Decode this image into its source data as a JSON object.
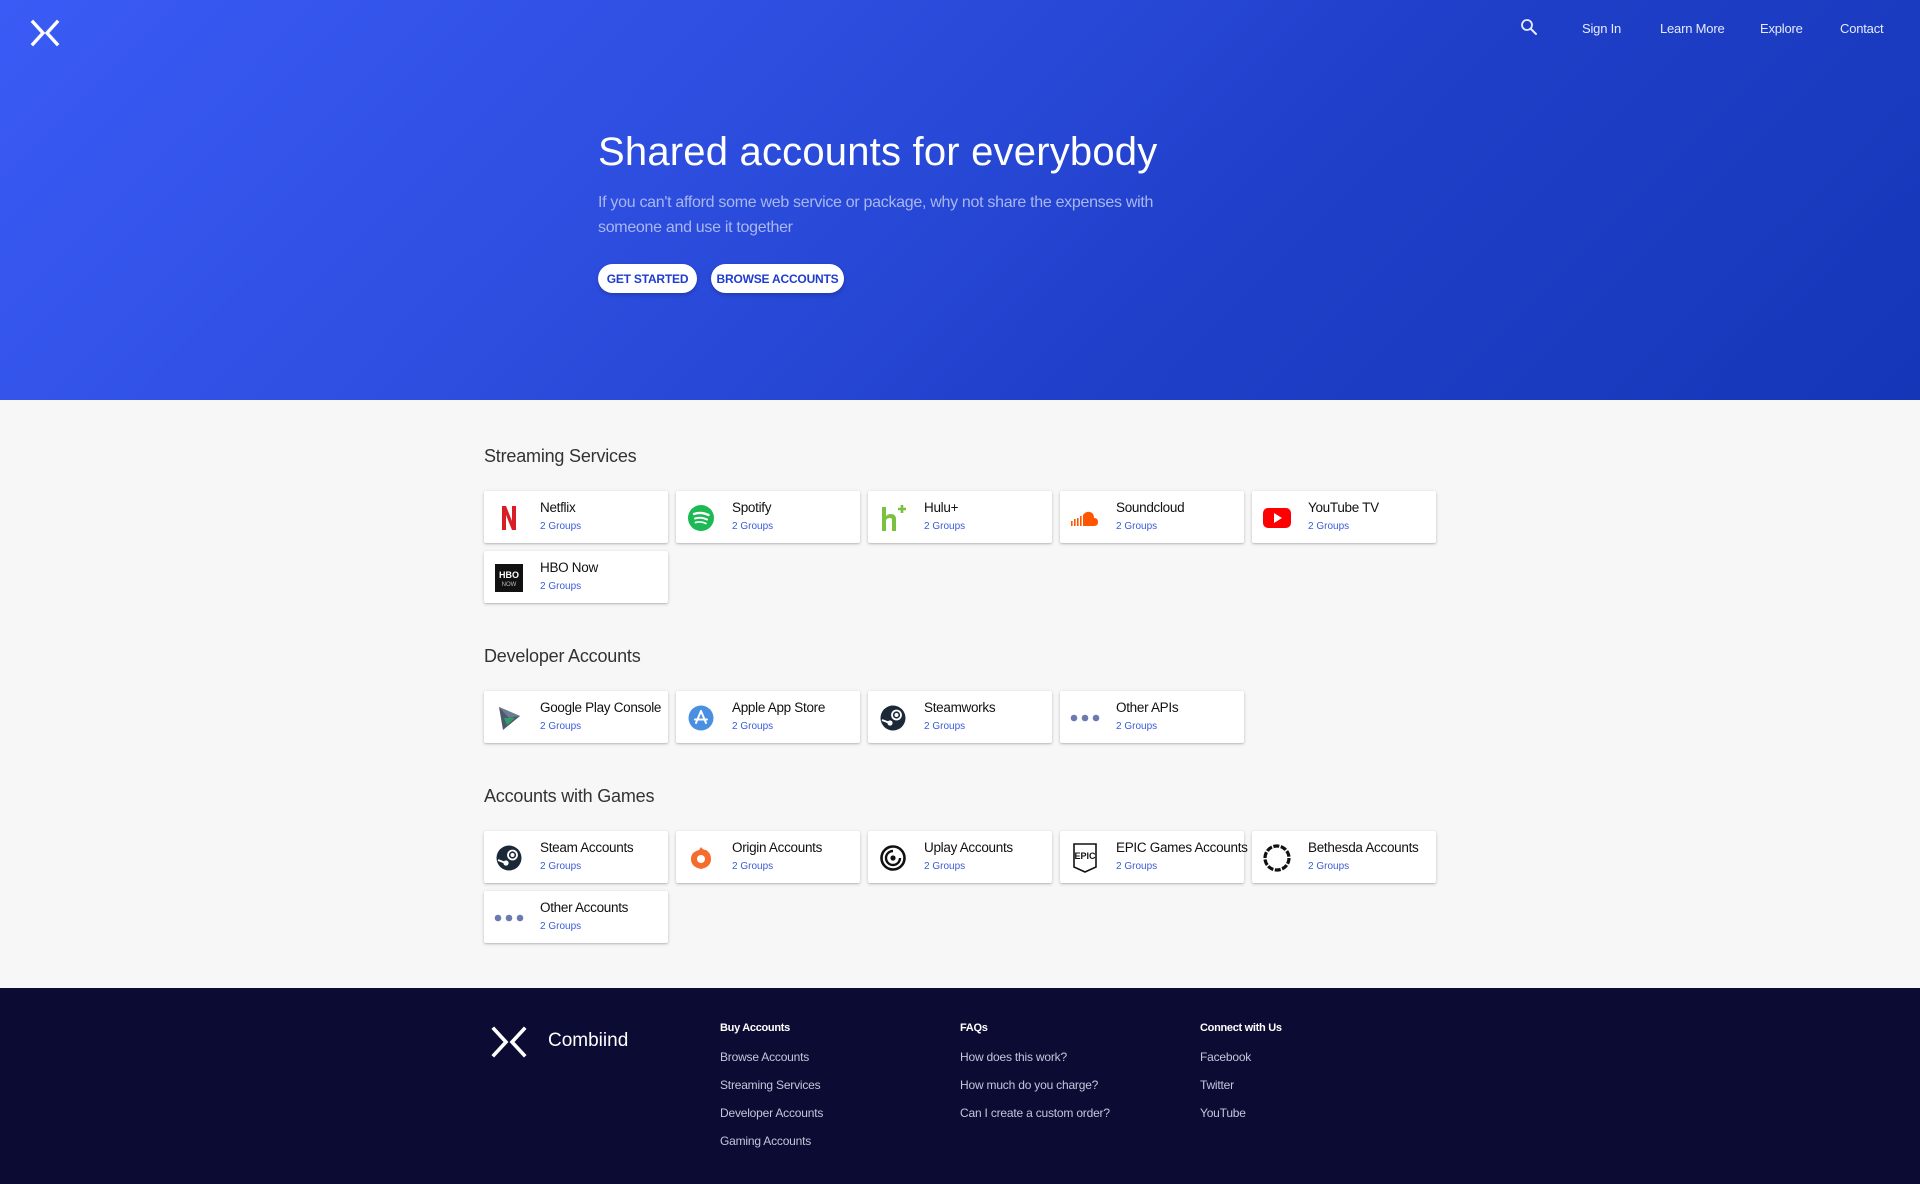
{
  "header": {
    "nav": [
      "Sign In",
      "Learn More",
      "Explore",
      "Contact"
    ]
  },
  "hero": {
    "title": "Shared accounts for everybody",
    "subtitle": "If you can't afford some web service or package, why not share the expenses with someone and use it together",
    "primary_button": "GET STARTED",
    "secondary_button": "BROWSE ACCOUNTS"
  },
  "sections": [
    {
      "title": "Streaming Services",
      "cards": [
        {
          "name": "Netflix",
          "groups": "2 Groups",
          "icon": "netflix-icon"
        },
        {
          "name": "Spotify",
          "groups": "2 Groups",
          "icon": "spotify-icon"
        },
        {
          "name": "Hulu+",
          "groups": "2 Groups",
          "icon": "hulu-icon"
        },
        {
          "name": "Soundcloud",
          "groups": "2 Groups",
          "icon": "soundcloud-icon"
        },
        {
          "name": "YouTube TV",
          "groups": "2 Groups",
          "icon": "youtube-icon"
        },
        {
          "name": "HBO Now",
          "groups": "2 Groups",
          "icon": "hbo-now-icon"
        }
      ]
    },
    {
      "title": "Developer Accounts",
      "cards": [
        {
          "name": "Google Play Console",
          "groups": "2 Groups",
          "icon": "google-play-icon"
        },
        {
          "name": "Apple App Store",
          "groups": "2 Groups",
          "icon": "app-store-icon"
        },
        {
          "name": "Steamworks",
          "groups": "2 Groups",
          "icon": "steam-icon"
        },
        {
          "name": "Other APIs",
          "groups": "2 Groups",
          "icon": "more-dots-icon"
        }
      ]
    },
    {
      "title": "Accounts with Games",
      "cards": [
        {
          "name": "Steam Accounts",
          "groups": "2 Groups",
          "icon": "steam-icon"
        },
        {
          "name": "Origin Accounts",
          "groups": "2 Groups",
          "icon": "origin-icon"
        },
        {
          "name": "Uplay Accounts",
          "groups": "2 Groups",
          "icon": "uplay-icon"
        },
        {
          "name": "EPIC Games Accounts",
          "groups": "2 Groups",
          "icon": "epic-games-icon"
        },
        {
          "name": "Bethesda Accounts",
          "groups": "2 Groups",
          "icon": "bethesda-icon"
        },
        {
          "name": "Other Accounts",
          "groups": "2 Groups",
          "icon": "more-dots-icon"
        }
      ]
    }
  ],
  "footer": {
    "brand": "Combiind",
    "columns": [
      {
        "heading": "Buy Accounts",
        "links": [
          "Browse Accounts",
          "Streaming Services",
          "Developer Accounts",
          "Gaming Accounts"
        ]
      },
      {
        "heading": "FAQs",
        "links": [
          "How does this work?",
          "How much do you charge?",
          "Can I create a custom order?"
        ]
      },
      {
        "heading": "Connect with Us",
        "links": [
          "Facebook",
          "Twitter",
          "YouTube"
        ]
      }
    ]
  },
  "colors": {
    "hero_gradient_start": "#3a5bf5",
    "hero_gradient_end": "#1636b8",
    "accent": "#3a5bd9",
    "footer_bg": "#0c0b33"
  }
}
